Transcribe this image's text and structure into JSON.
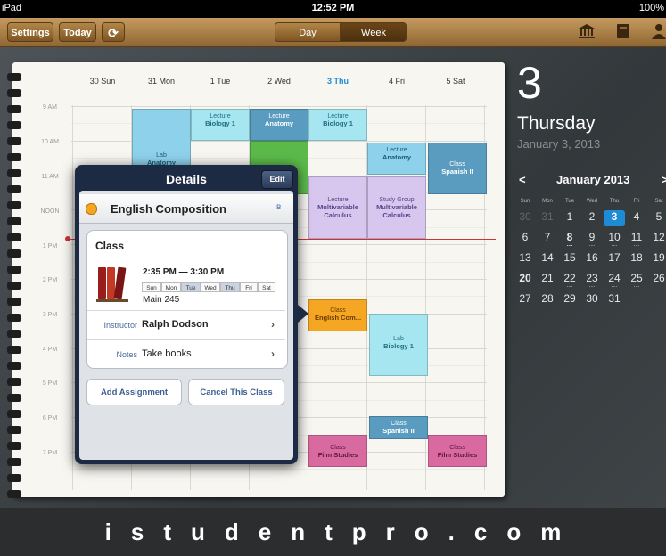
{
  "status": {
    "carrier": "iPad",
    "time": "12:52 PM",
    "battery": "100%"
  },
  "toolbar": {
    "settings": "Settings",
    "today": "Today",
    "views": [
      "Day",
      "Week"
    ],
    "active_view": "Week",
    "icons": [
      "refresh-icon",
      "institution-icon",
      "notebook-icon",
      "person-icon"
    ]
  },
  "week": {
    "days": [
      "30 Sun",
      "31 Mon",
      "1 Tue",
      "2 Wed",
      "3 Thu",
      "4 Fri",
      "5 Sat"
    ],
    "today_label": "3 Thu",
    "times": [
      "9 AM",
      "10 AM",
      "11 AM",
      "NOON",
      "1 PM",
      "2 PM",
      "3 PM",
      "4 PM",
      "5 PM",
      "6 PM",
      "7 PM"
    ]
  },
  "events": [
    {
      "type": "Lecture",
      "subject": "Biology 1"
    },
    {
      "type": "Lecture",
      "subject": "Anatomy"
    },
    {
      "type": "Lecture",
      "subject": "Biology 1"
    },
    {
      "type": "Lab",
      "subject": "Anatomy"
    },
    {
      "type": "Lecture",
      "subject": "Anatomy"
    },
    {
      "type": "Class",
      "subject": "Spanish II"
    },
    {
      "type": "Lecture",
      "subject": "Multivariable Calculus"
    },
    {
      "type": "Study Group",
      "subject": "Multivariable Calculus"
    },
    {
      "type": "Class",
      "subject": "English Com..."
    },
    {
      "type": "Lab",
      "subject": "Biology 1"
    },
    {
      "type": "Class",
      "subject": "Spanish II"
    },
    {
      "type": "Class",
      "subject": "Film Studies"
    },
    {
      "type": "Class",
      "subject": "Film Studies"
    }
  ],
  "side": {
    "day_number": "3",
    "weekday": "Thursday",
    "date": "January 3, 2013",
    "month_title": "January 2013",
    "prev": "<",
    "next": ">",
    "dow": [
      "Sun",
      "Mon",
      "Tue",
      "Wed",
      "Thu",
      "Fri",
      "Sat"
    ],
    "weeks": [
      [
        "30",
        "31",
        "1",
        "2",
        "3",
        "4",
        "5"
      ],
      [
        "6",
        "7",
        "8",
        "9",
        "10",
        "11",
        "12"
      ],
      [
        "13",
        "14",
        "15",
        "16",
        "17",
        "18",
        "19"
      ],
      [
        "20",
        "21",
        "22",
        "23",
        "24",
        "25",
        "26"
      ],
      [
        "27",
        "28",
        "29",
        "30",
        "31",
        "",
        ""
      ]
    ]
  },
  "popover": {
    "title": "Details",
    "edit": "Edit",
    "course": "English Composition",
    "course_color": "#f5a623",
    "bluetooth_glyph": "ʙ",
    "section_title": "Class",
    "time_range": "2:35 PM — 3:30 PM",
    "weekdays": [
      "Sun",
      "Mon",
      "Tue",
      "Wed",
      "Thu",
      "Fri",
      "Sat"
    ],
    "room": "Main 245",
    "instructor_label": "Instructor",
    "instructor": "Ralph Dodson",
    "notes_label": "Notes",
    "notes": "Take books",
    "add_assignment": "Add Assignment",
    "cancel_class": "Cancel This Class"
  },
  "watermark": "istudentpro.com"
}
